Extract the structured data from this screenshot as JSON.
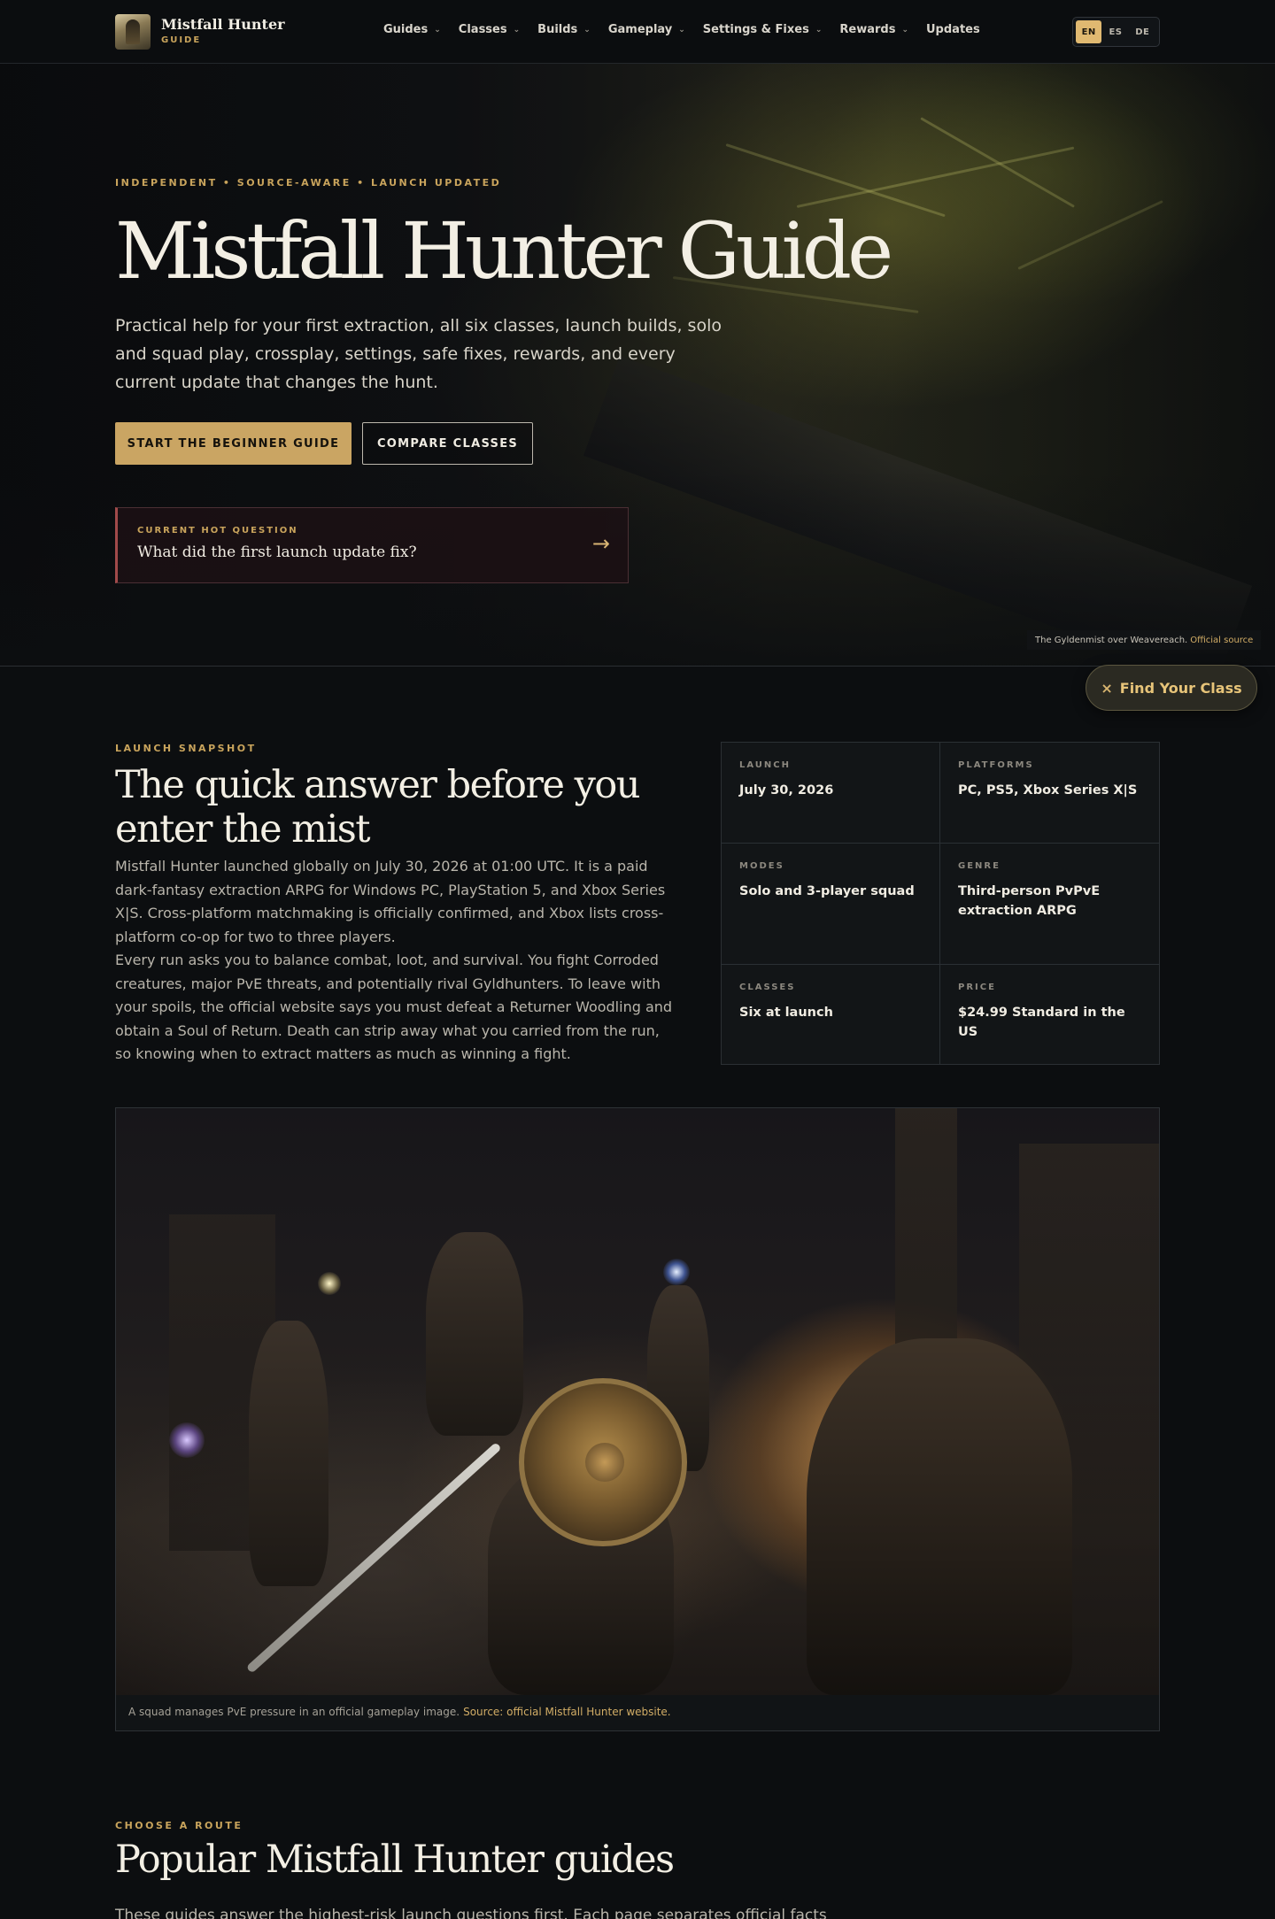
{
  "header": {
    "brand_name": "Mistfall Hunter",
    "brand_sub": "GUIDE",
    "nav": [
      {
        "label": "Guides",
        "has_menu": true
      },
      {
        "label": "Classes",
        "has_menu": true
      },
      {
        "label": "Builds",
        "has_menu": true
      },
      {
        "label": "Gameplay",
        "has_menu": true
      },
      {
        "label": "Settings & Fixes",
        "has_menu": true
      },
      {
        "label": "Rewards",
        "has_menu": true
      },
      {
        "label": "Updates",
        "has_menu": false
      }
    ],
    "languages": [
      "EN",
      "ES",
      "DE"
    ],
    "active_language": "EN",
    "chevron_glyph": "⌄"
  },
  "hero": {
    "eyebrow": "INDEPENDENT • SOURCE-AWARE • LAUNCH UPDATED",
    "title": "Mistfall Hunter Guide",
    "description": "Practical help for your first extraction, all six classes, launch builds, solo and squad play, crossplay, settings, safe fixes, rewards, and every current update that changes the hunt.",
    "primary_cta": "START THE BEGINNER GUIDE",
    "secondary_cta": "COMPARE CLASSES",
    "hot_label": "CURRENT HOT QUESTION",
    "hot_question": "What did the first launch update fix?",
    "hot_arrow": "→",
    "credit_text": "The Gyldenmist over Weavereach.",
    "credit_link": "Official source"
  },
  "find_class": {
    "icon": "×",
    "label": "Find Your Class"
  },
  "snapshot": {
    "eyebrow": "LAUNCH SNAPSHOT",
    "title": "The quick answer before you enter the mist",
    "paragraphs": [
      "Mistfall Hunter launched globally on July 30, 2026 at 01:00 UTC. It is a paid dark-fantasy extraction ARPG for Windows PC, PlayStation 5, and Xbox Series X|S. Cross-platform matchmaking is officially confirmed, and Xbox lists cross-platform co-op for two to three players.",
      "Every run asks you to balance combat, loot, and survival. You fight Corroded creatures, major PvE threats, and potentially rival Gyldhunters. To leave with your spoils, the official website says you must defeat a Returner Woodling and obtain a Soul of Return. Death can strip away what you carried from the run, so knowing when to extract matters as much as winning a fight."
    ],
    "facts": [
      {
        "label": "LAUNCH",
        "value": "July 30, 2026"
      },
      {
        "label": "PLATFORMS",
        "value": "PC, PS5, Xbox Series X|S"
      },
      {
        "label": "MODES",
        "value": "Solo and 3-player squad"
      },
      {
        "label": "GENRE",
        "value": "Third-person PvPvE extraction ARPG"
      },
      {
        "label": "CLASSES",
        "value": "Six at launch"
      },
      {
        "label": "PRICE",
        "value": "$24.99 Standard in the US"
      }
    ]
  },
  "figure": {
    "caption": "A squad manages PvE pressure in an official gameplay image.",
    "caption_link": "Source: official Mistfall Hunter website."
  },
  "guides": {
    "eyebrow": "CHOOSE A ROUTE",
    "title": "Popular Mistfall Hunter guides",
    "intro": "These guides answer the highest-risk launch questions first. Each page separates official facts"
  },
  "colors": {
    "accent": "#caa563",
    "background": "#0c0e10",
    "hot_border": "#a14a4a"
  }
}
